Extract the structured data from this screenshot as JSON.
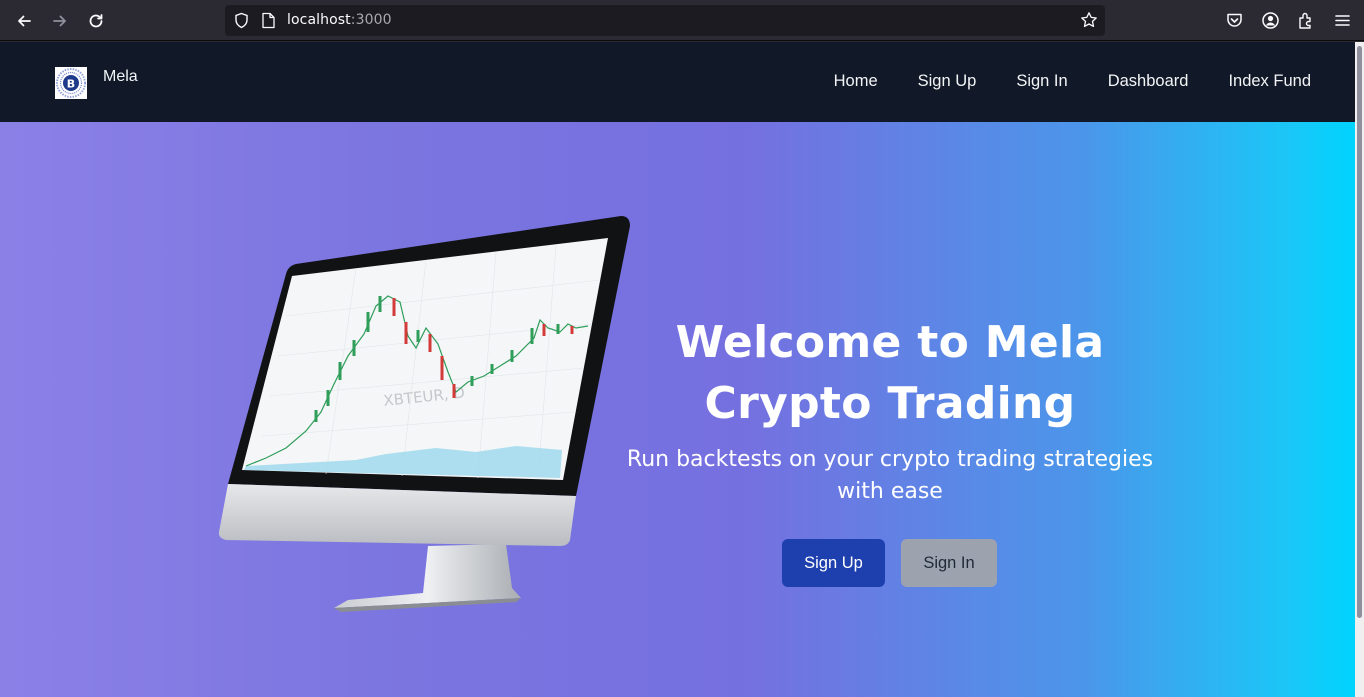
{
  "browser": {
    "url_host": "localhost",
    "url_port": ":3000"
  },
  "site": {
    "brand": "Mela",
    "nav": [
      "Home",
      "Sign Up",
      "Sign In",
      "Dashboard",
      "Index Fund"
    ]
  },
  "hero": {
    "title_line1": "Welcome to Mela",
    "title_line2": "Crypto Trading",
    "subtitle_line1": "Run backtests on your crypto trading strategies",
    "subtitle_line2": "with ease",
    "signup_label": "Sign Up",
    "signin_label": "Sign In",
    "screen_watermark": "XBTEUR, D",
    "screen_sub": "XBTEUR"
  },
  "colors": {
    "navbar_bg": "#111827",
    "hero_gradient_start": "#8b80e6",
    "hero_gradient_end": "#00d4ff",
    "signup_btn": "#1e40af",
    "signin_btn": "#9ca3af"
  }
}
